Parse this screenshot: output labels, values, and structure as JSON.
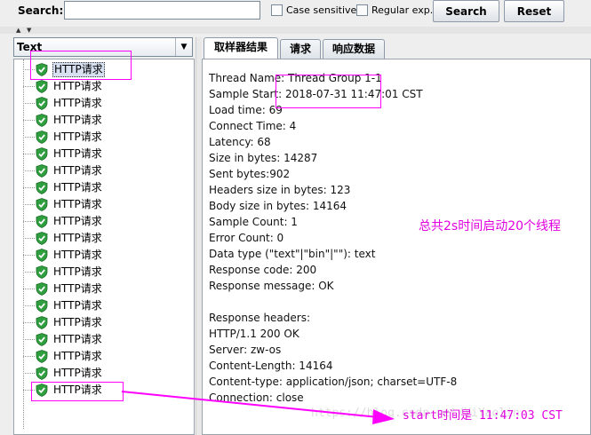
{
  "search": {
    "label": "Search:",
    "value": "",
    "case_sensitive_label": "Case sensitive",
    "regex_label": "Regular exp.",
    "search_button": "Search",
    "reset_button": "Reset"
  },
  "renderer": {
    "selected": "Text"
  },
  "tree": {
    "items": [
      {
        "label": "HTTP请求"
      },
      {
        "label": "HTTP请求"
      },
      {
        "label": "HTTP请求"
      },
      {
        "label": "HTTP请求"
      },
      {
        "label": "HTTP请求"
      },
      {
        "label": "HTTP请求"
      },
      {
        "label": "HTTP请求"
      },
      {
        "label": "HTTP请求"
      },
      {
        "label": "HTTP请求"
      },
      {
        "label": "HTTP请求"
      },
      {
        "label": "HTTP请求"
      },
      {
        "label": "HTTP请求"
      },
      {
        "label": "HTTP请求"
      },
      {
        "label": "HTTP请求"
      },
      {
        "label": "HTTP请求"
      },
      {
        "label": "HTTP请求"
      },
      {
        "label": "HTTP请求"
      },
      {
        "label": "HTTP请求"
      },
      {
        "label": "HTTP请求"
      },
      {
        "label": "HTTP请求"
      }
    ],
    "selected_index": 0,
    "status_icon": "green-shield-check-icon"
  },
  "tabs": [
    {
      "label": "取样器结果",
      "active": true
    },
    {
      "label": "请求",
      "active": false
    },
    {
      "label": "响应数据",
      "active": false
    }
  ],
  "result": {
    "lines": [
      "Thread Name: Thread Group 1-1",
      "Sample Start: 2018-07-31 11:47:01 CST",
      "Load time: 69",
      "Connect Time: 4",
      "Latency: 68",
      "Size in bytes: 14287",
      "Sent bytes:902",
      "Headers size in bytes: 123",
      "Body size in bytes: 14164",
      "Sample Count: 1",
      "Error Count: 0",
      "Data type (\"text\"|\"bin\"|\"\"): text",
      "Response code: 200",
      "Response message: OK",
      "",
      "Response headers:",
      "HTTP/1.1 200 OK",
      "Server: zw-os",
      "Content-Length: 14164",
      "Content-type: application/json; charset=UTF-8",
      "Connection: close"
    ]
  },
  "annotations": {
    "note_total": "总共2s时间启动20个线程",
    "note_start": "start时间是 11:47:03 CST",
    "watermark": "https://blog.csdn.net/YiYaolin",
    "color": "#ff00ff"
  }
}
